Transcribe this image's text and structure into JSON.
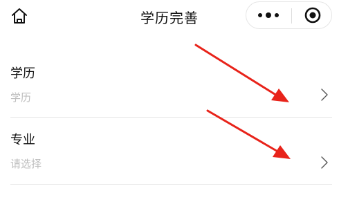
{
  "nav": {
    "title": "学历完善",
    "home_icon": "home-icon",
    "more_icon": "more-dots-icon",
    "close_icon": "target-close-icon"
  },
  "form": {
    "rows": [
      {
        "label": "学历",
        "value": "学历",
        "arrow_icon": "chevron-right-icon"
      },
      {
        "label": "专业",
        "value": "请选择",
        "arrow_icon": "chevron-right-icon"
      }
    ]
  },
  "annotations": {
    "arrow_color": "#e8231a"
  },
  "colors": {
    "text": "#111111",
    "placeholder": "#bdbdbd",
    "divider": "#e6e6e6"
  }
}
